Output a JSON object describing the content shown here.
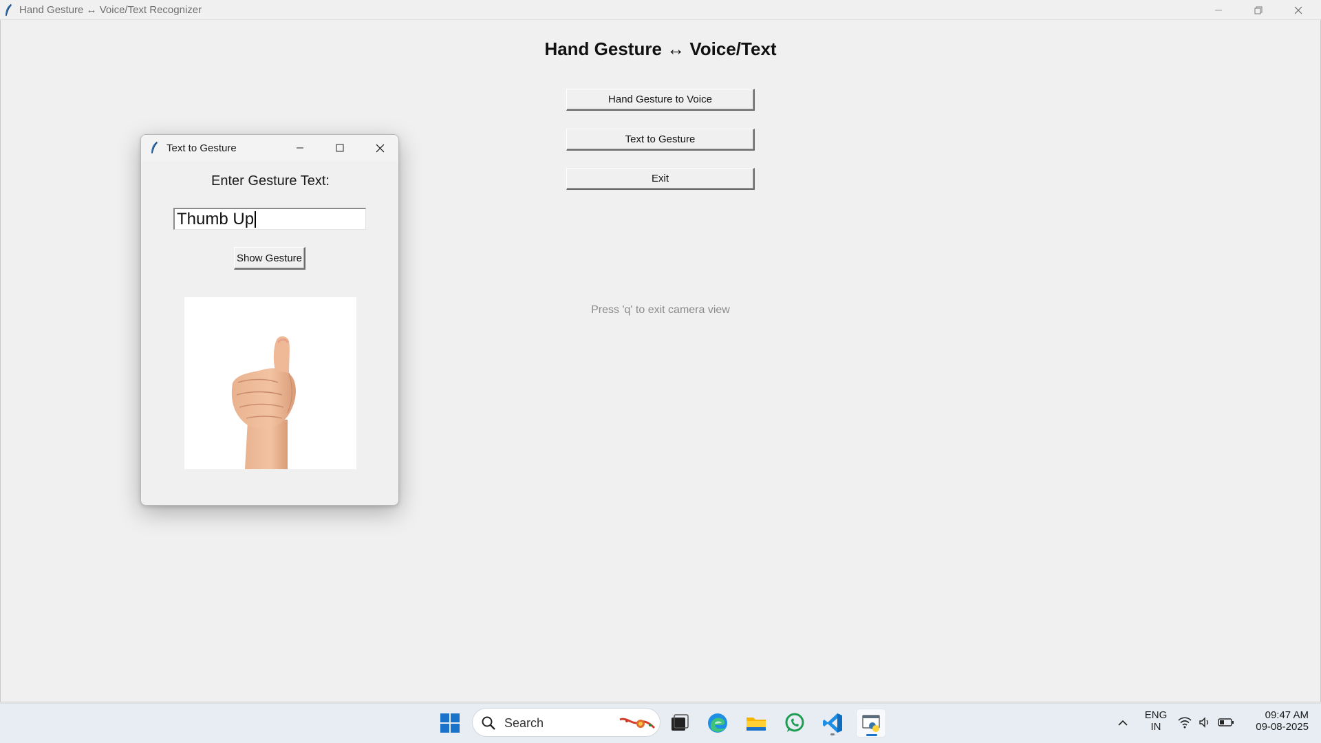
{
  "main_window": {
    "title": "Hand Gesture ↔ Voice/Text Recognizer",
    "heading": "Hand Gesture ↔ Voice/Text",
    "buttons": {
      "gesture_to_voice": "Hand Gesture to Voice",
      "text_to_gesture": "Text to Gesture",
      "exit": "Exit"
    },
    "hint": "Press 'q' to exit camera view"
  },
  "child_window": {
    "title": "Text to Gesture",
    "prompt": "Enter Gesture Text:",
    "input_value": "Thumb Up",
    "show_button": "Show Gesture",
    "image": "thumbs-up-hand"
  },
  "taskbar": {
    "search_placeholder": "Search",
    "apps": [
      "start-icon",
      "search-icon",
      "task-view-icon",
      "edge-icon",
      "file-explorer-icon",
      "whatsapp-icon",
      "vscode-icon",
      "python-tk-icon"
    ],
    "tray": {
      "language": "ENG",
      "region": "IN",
      "time": "09:47 AM",
      "date": "09-08-2025"
    }
  },
  "colors": {
    "window_bg": "#f0f0f0",
    "taskbar_bg": "#e8edf3",
    "accent": "#1a73c8",
    "hint_text": "#8a8a8a"
  }
}
